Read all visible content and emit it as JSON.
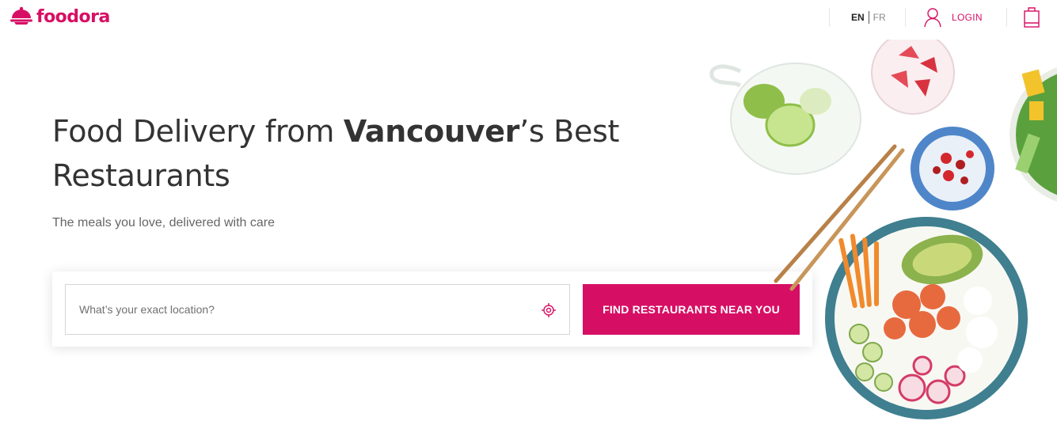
{
  "brand": {
    "name": "foodora",
    "color": "#d70f64",
    "logo_icon": "cloche-icon"
  },
  "header": {
    "languages": [
      {
        "code": "EN",
        "active": true
      },
      {
        "code": "FR",
        "active": false
      }
    ],
    "login_label": "LOGIN",
    "login_icon": "user-icon",
    "cart_icon": "cart-bag-icon"
  },
  "hero": {
    "title_before": "Food Delivery from ",
    "title_city": "Vancouver",
    "title_after": "’s Best Restaurants",
    "subtitle": "The meals you love, delivered with care"
  },
  "search": {
    "placeholder": "What’s your exact location?",
    "value": "",
    "locate_icon": "crosshair-location-icon",
    "button_label": "FIND RESTAURANTS NEAR YOU"
  },
  "colors": {
    "accent": "#d70f64",
    "text": "#333333",
    "muted": "#666666"
  }
}
